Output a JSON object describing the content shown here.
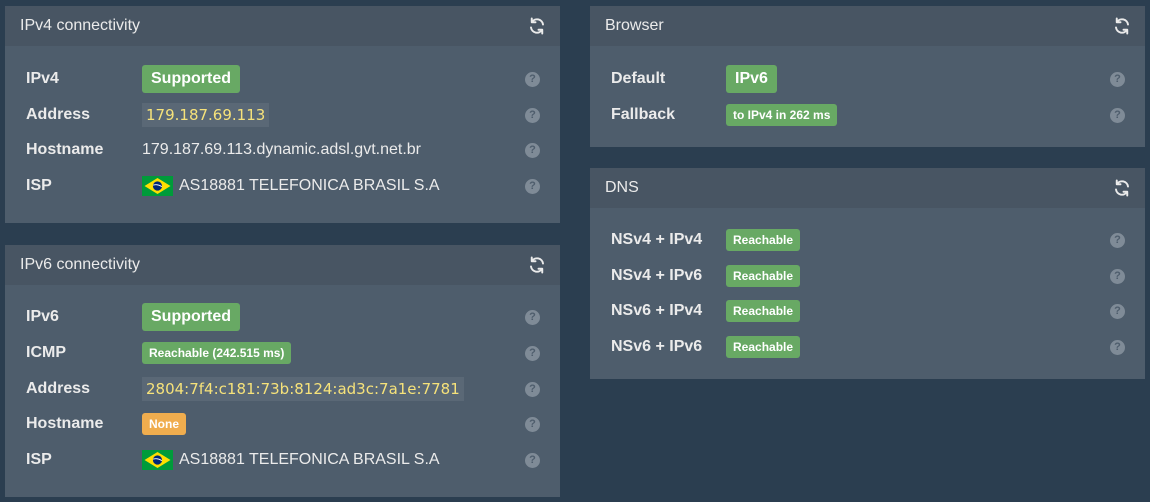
{
  "ipv4": {
    "title": "IPv4 connectivity",
    "rows": [
      {
        "label": "IPv4",
        "value": "Supported"
      },
      {
        "label": "Address",
        "value": "179.187.69.113"
      },
      {
        "label": "Hostname",
        "value": "179.187.69.113.dynamic.adsl.gvt.net.br"
      },
      {
        "label": "ISP",
        "value": "AS18881 TELEFONICA BRASIL S.A"
      }
    ]
  },
  "ipv6": {
    "title": "IPv6 connectivity",
    "rows": [
      {
        "label": "IPv6",
        "value": "Supported"
      },
      {
        "label": "ICMP",
        "value": "Reachable (242.515 ms)"
      },
      {
        "label": "Address",
        "value": "2804:7f4:c181:73b:8124:ad3c:7a1e:7781"
      },
      {
        "label": "Hostname",
        "value": "None"
      },
      {
        "label": "ISP",
        "value": "AS18881 TELEFONICA BRASIL S.A"
      }
    ]
  },
  "browser": {
    "title": "Browser",
    "rows": [
      {
        "label": "Default",
        "value": "IPv6"
      },
      {
        "label": "Fallback",
        "value": "to IPv4 in 262 ms"
      }
    ]
  },
  "dns": {
    "title": "DNS",
    "rows": [
      {
        "label": "NSv4 + IPv4",
        "value": "Reachable"
      },
      {
        "label": "NSv4 + IPv6",
        "value": "Reachable"
      },
      {
        "label": "NSv6 + IPv4",
        "value": "Reachable"
      },
      {
        "label": "NSv6 + IPv6",
        "value": "Reachable"
      }
    ]
  },
  "help_glyph": "?",
  "icons": {
    "refresh": "refresh-icon",
    "help": "help-icon",
    "flag": "brazil-flag-icon"
  },
  "colors": {
    "background": "#2b3e50",
    "panel": "#4e5d6c",
    "success": "#68a964",
    "warning": "#f0ad4e",
    "code_text": "#f6e27a"
  }
}
